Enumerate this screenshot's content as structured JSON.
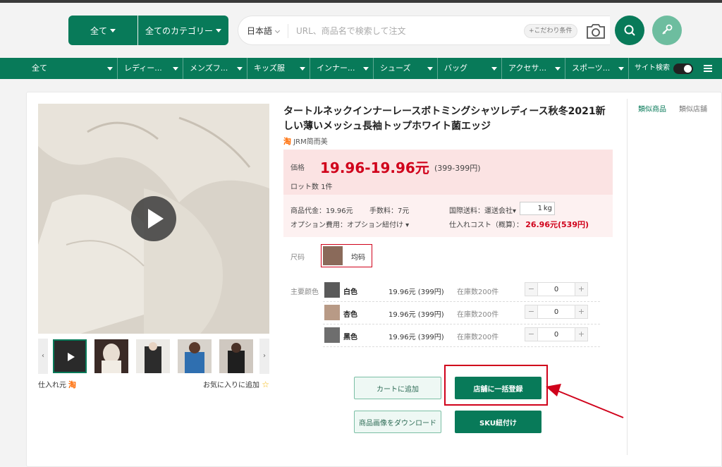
{
  "header": {
    "all_label": "全て",
    "category_label": "全てのカテゴリー",
    "language": "日本語",
    "search_placeholder": "URL、商品名で検索して注文",
    "conditions_label": "+こだわり条件"
  },
  "nav": {
    "items": [
      {
        "label": "全て"
      },
      {
        "label": "レディー..."
      },
      {
        "label": "メンズフ..."
      },
      {
        "label": "キッズ服"
      },
      {
        "label": "インナー..."
      },
      {
        "label": "シューズ"
      },
      {
        "label": "バッグ"
      },
      {
        "label": "アクセサ..."
      },
      {
        "label": "スポーツ..."
      }
    ],
    "site_search_label": "サイト検索"
  },
  "product": {
    "title": "タートルネックインナーレースボトミングシャツレディース秋冬2021新しい薄いメッシュ長袖トップホワイト菌エッジ",
    "shop_name": "JRM简而美",
    "taobao_mark": "淘",
    "price_label": "価格",
    "price": "19.96-19.96元",
    "price_sub": "(399-399円)",
    "lot_label": "ロット数",
    "lot_value": "1件",
    "fees": {
      "product_price": "商品代金：19.96元",
      "handling_fee": "手数料：7元",
      "intl_shipping_label": "国際送料：",
      "carrier_label": "運送会社",
      "weight_value": "1",
      "weight_unit": "kg",
      "option_fee": "オプション費用：",
      "option_link": "オプション紐付け",
      "purchase_cost_label": "仕入れコスト（概算）：",
      "purchase_cost_value": "26.96元(539円)"
    },
    "size_label": "尺码",
    "size_option": "均码",
    "color_label": "主要颜色",
    "colors": [
      {
        "name": "白色",
        "price": "19.96元 (399円)",
        "stock": "在庫数200件",
        "qty": "0",
        "swatch": "#5a5a5a"
      },
      {
        "name": "杏色",
        "price": "19.96元 (399円)",
        "stock": "在庫数200件",
        "qty": "0",
        "swatch": "#b89a86"
      },
      {
        "name": "黑色",
        "price": "19.96元 (399円)",
        "stock": "在庫数200件",
        "qty": "0",
        "swatch": "#6e6e6e"
      }
    ],
    "source_label": "仕入れ元",
    "favorite_label": "お気に入りに追加"
  },
  "actions": {
    "add_to_cart": "カートに追加",
    "bulk_register": "店舗に一括登録",
    "download_images": "商品画像をダウンロード",
    "sku_link": "SKU紐付け"
  },
  "side_tabs": {
    "similar_products": "類似商品",
    "similar_shops": "類似店舗"
  },
  "colors": {
    "brand_green": "#087a59",
    "price_red": "#d0021b",
    "annotation_red": "#d0021b"
  }
}
